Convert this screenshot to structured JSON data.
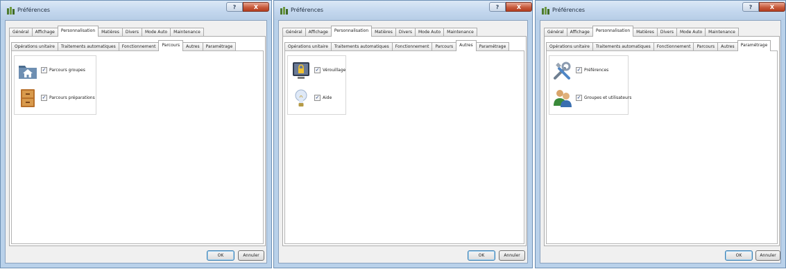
{
  "dialogs": [
    {
      "title": "Préférences",
      "help_label": "?",
      "close_label": "X",
      "top_tabs": [
        "Général",
        "Affichage",
        "Personnalisation",
        "Matières",
        "Divers",
        "Mode Auto",
        "Maintenance"
      ],
      "top_active": "Personnalisation",
      "sub_tabs": [
        "Opérations unitaire",
        "Traitements automatiques",
        "Fonctionnement",
        "Parcours",
        "Autres",
        "Paramétrage"
      ],
      "sub_active": "Parcours",
      "items": [
        {
          "label": "Parcours groupes",
          "checked": true,
          "icon": "home-folder-icon"
        },
        {
          "label": "Parcours préparations",
          "checked": true,
          "icon": "cabinet-icon"
        }
      ],
      "ok_label": "OK",
      "cancel_label": "Annuler"
    },
    {
      "title": "Préférences",
      "help_label": "?",
      "close_label": "X",
      "top_tabs": [
        "Général",
        "Affichage",
        "Personnalisation",
        "Matières",
        "Divers",
        "Mode Auto",
        "Maintenance"
      ],
      "top_active": "Personnalisation",
      "sub_tabs": [
        "Opérations unitaire",
        "Traitements automatiques",
        "Fonctionnement",
        "Parcours",
        "Autres",
        "Paramétrage"
      ],
      "sub_active": "Autres",
      "items": [
        {
          "label": "Vérouillage",
          "checked": true,
          "icon": "lock-screen-icon"
        },
        {
          "label": "Aide",
          "checked": true,
          "icon": "lightbulb-icon"
        }
      ],
      "ok_label": "OK",
      "cancel_label": "Annuler"
    },
    {
      "title": "Préférences",
      "help_label": "?",
      "close_label": "X",
      "top_tabs": [
        "Général",
        "Affichage",
        "Personnalisation",
        "Matières",
        "Divers",
        "Mode Auto",
        "Maintenance"
      ],
      "top_active": "Personnalisation",
      "sub_tabs": [
        "Opérations unitaire",
        "Traitements automatiques",
        "Fonctionnement",
        "Parcours",
        "Autres",
        "Paramétrage"
      ],
      "sub_active": "Paramétrage",
      "items": [
        {
          "label": "Préférences",
          "checked": true,
          "icon": "tools-icon"
        },
        {
          "label": "Groupes et utilisateurs",
          "checked": true,
          "icon": "users-icon"
        }
      ],
      "ok_label": "OK",
      "cancel_label": "Annuler"
    }
  ],
  "colors": {
    "window_frame": "#b9d1ea",
    "close_button": "#c75b3d",
    "panel_background": "#ffffff",
    "dialog_background": "#f0f0f0"
  }
}
